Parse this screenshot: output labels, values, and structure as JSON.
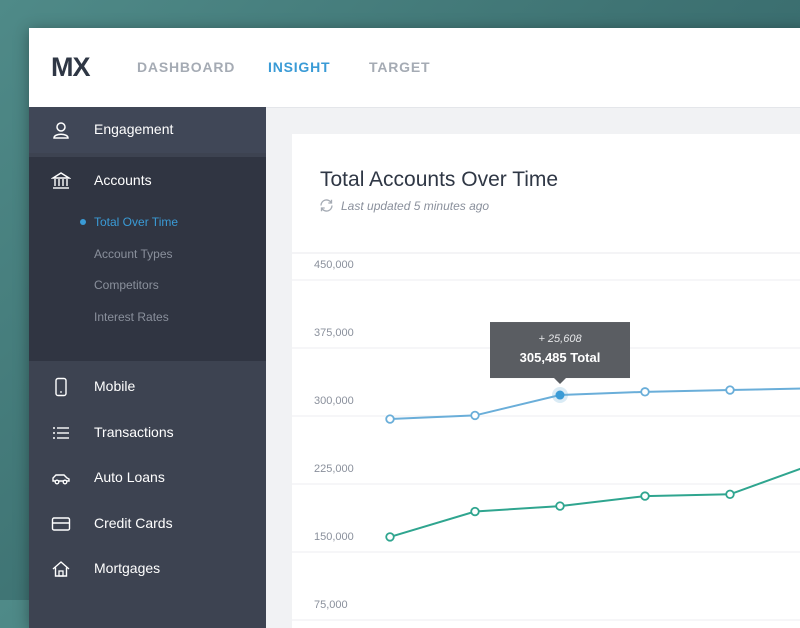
{
  "app": {
    "logo": "MX"
  },
  "nav": {
    "tabs": [
      {
        "label": "DASHBOARD",
        "active": false
      },
      {
        "label": "INSIGHT",
        "active": true
      },
      {
        "label": "TARGET",
        "active": false
      }
    ]
  },
  "sidebar": {
    "items": [
      {
        "label": "Engagement",
        "icon": "user-icon"
      },
      {
        "label": "Accounts",
        "icon": "bank-icon"
      },
      {
        "label": "Mobile",
        "icon": "mobile-icon"
      },
      {
        "label": "Transactions",
        "icon": "list-icon"
      },
      {
        "label": "Auto Loans",
        "icon": "car-icon"
      },
      {
        "label": "Credit Cards",
        "icon": "credit-card-icon"
      },
      {
        "label": "Mortgages",
        "icon": "home-icon"
      }
    ],
    "accounts_sub": [
      {
        "label": "Total Over Time",
        "active": true
      },
      {
        "label": "Account Types",
        "active": false
      },
      {
        "label": "Competitors",
        "active": false
      },
      {
        "label": "Interest Rates",
        "active": false
      }
    ]
  },
  "card": {
    "title": "Total Accounts Over Time",
    "updated": "Last updated 5 minutes ago"
  },
  "colors": {
    "accent": "#3a9bd6",
    "series_blue": "#6aaed9",
    "series_green": "#2fa58f",
    "sidebar": "#3d4351"
  },
  "chart_data": {
    "type": "line",
    "y_ticks": [
      "450,000",
      "375,000",
      "300,000",
      "225,000",
      "150,000",
      "75,000"
    ],
    "ylim": [
      75000,
      450000
    ],
    "series": [
      {
        "values": [
          279000,
          283000,
          305485,
          309000,
          311000,
          313000
        ]
      },
      {
        "values": [
          149000,
          177000,
          183000,
          194000,
          196000,
          230000
        ]
      }
    ],
    "tooltip": {
      "delta": "+ 25,608",
      "total": "305,485 Total",
      "index": 2
    }
  }
}
